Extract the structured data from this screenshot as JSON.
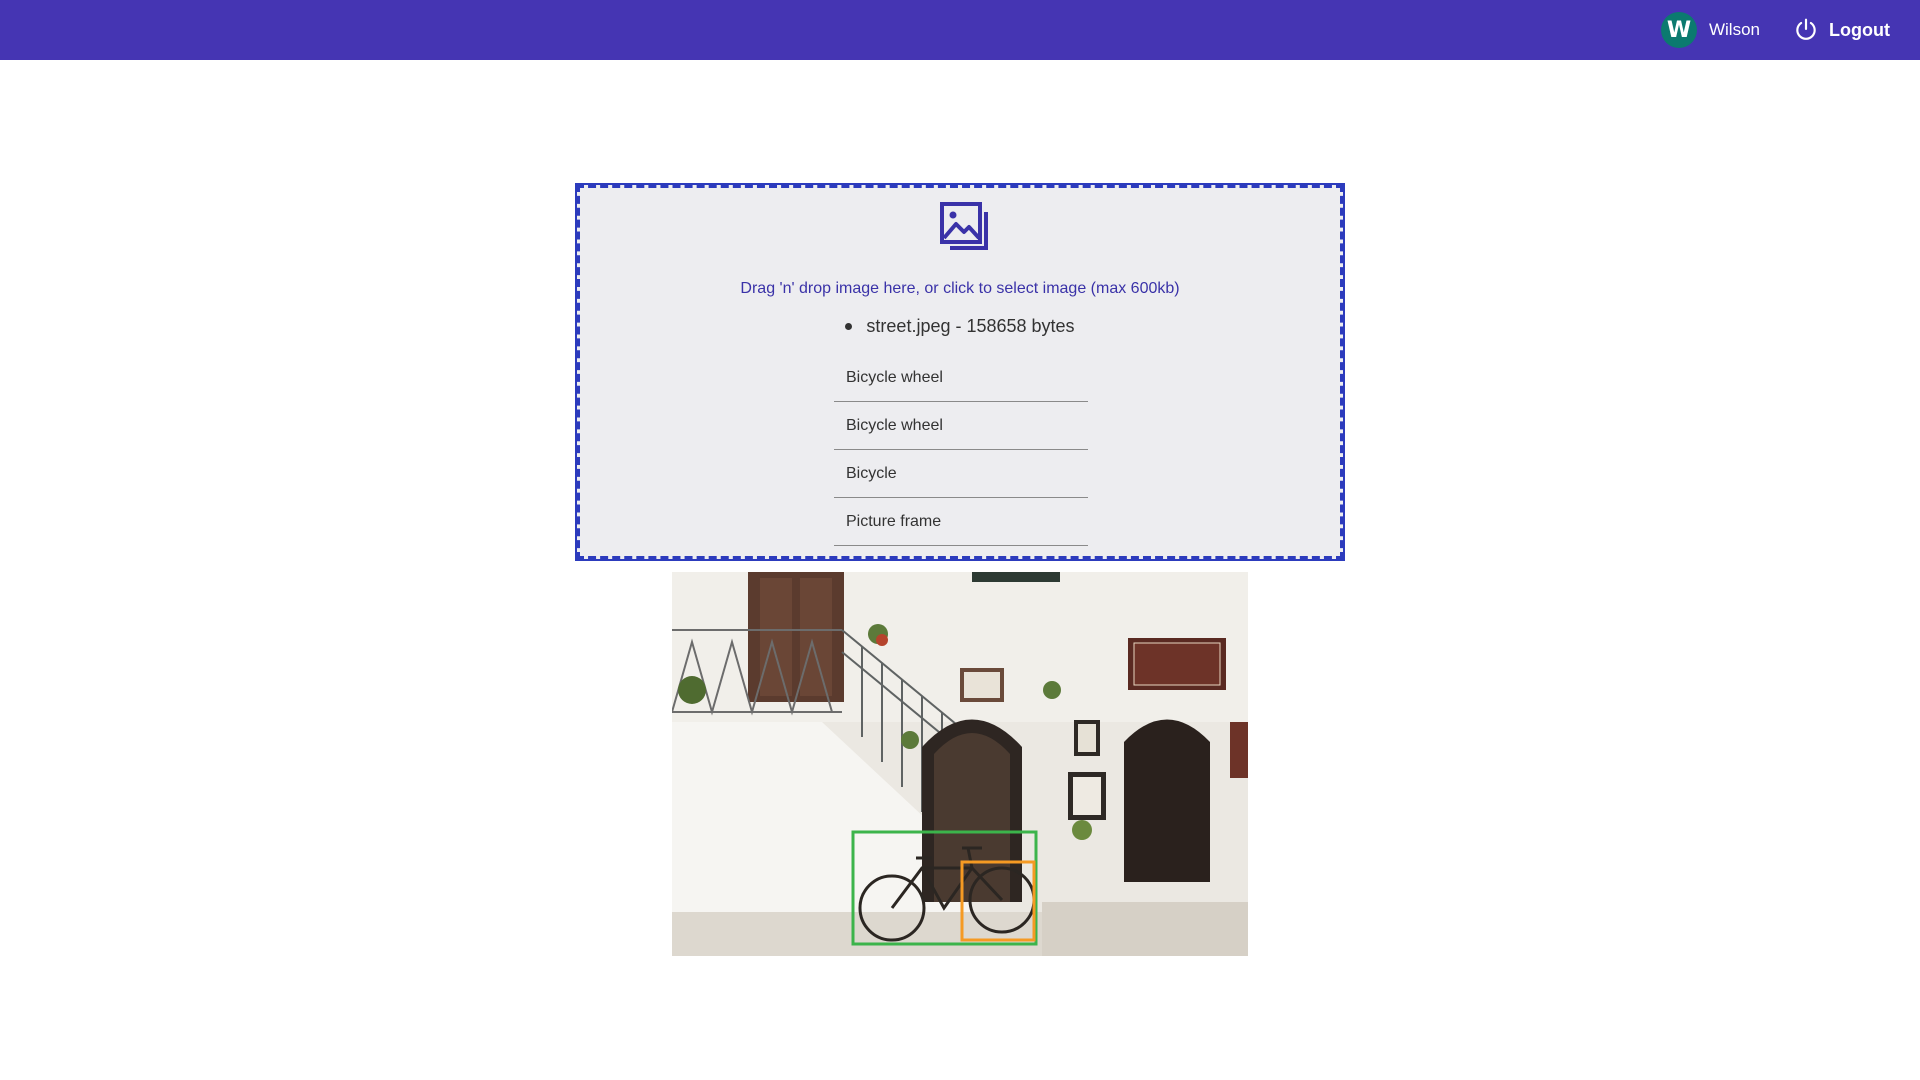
{
  "header": {
    "avatar_letter": "W",
    "username": "Wilson",
    "logout_label": "Logout",
    "bar_color": "#4535b3",
    "avatar_color": "#0b7a6f"
  },
  "dropzone": {
    "icon": "images-icon",
    "instruction": "Drag 'n' drop image here, or click to select image (max 600kb)",
    "files": [
      {
        "text": "street.jpeg - 158658 bytes"
      }
    ],
    "labels": [
      "Bicycle wheel",
      "Bicycle wheel",
      "Bicycle",
      "Picture frame"
    ],
    "border_color": "#2c3bbd"
  },
  "preview": {
    "box_colors": {
      "bicycle": "#3cb44b",
      "wheel": "#f59a23"
    }
  }
}
